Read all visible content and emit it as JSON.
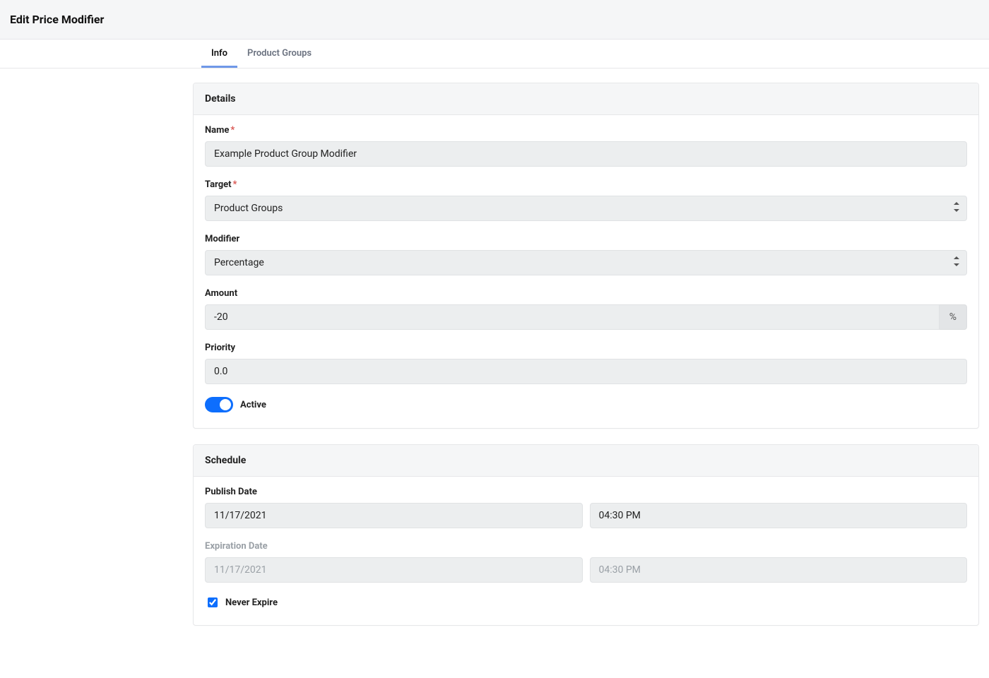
{
  "header": {
    "title": "Edit Price Modifier"
  },
  "tabs": [
    {
      "id": "info",
      "label": "Info",
      "active": true
    },
    {
      "id": "product-groups",
      "label": "Product Groups",
      "active": false
    }
  ],
  "details": {
    "section_title": "Details",
    "name_label": "Name",
    "name_value": "Example Product Group Modifier",
    "target_label": "Target",
    "target_value": "Product Groups",
    "modifier_label": "Modifier",
    "modifier_value": "Percentage",
    "amount_label": "Amount",
    "amount_value": "-20",
    "amount_suffix": "%",
    "priority_label": "Priority",
    "priority_value": "0.0",
    "active_label": "Active",
    "active_on": true
  },
  "schedule": {
    "section_title": "Schedule",
    "publish_label": "Publish Date",
    "publish_date": "11/17/2021",
    "publish_time": "04:30 PM",
    "expire_label": "Expiration Date",
    "expire_date": "11/17/2021",
    "expire_time": "04:30 PM",
    "never_expire_label": "Never Expire",
    "never_expire_checked": true
  }
}
